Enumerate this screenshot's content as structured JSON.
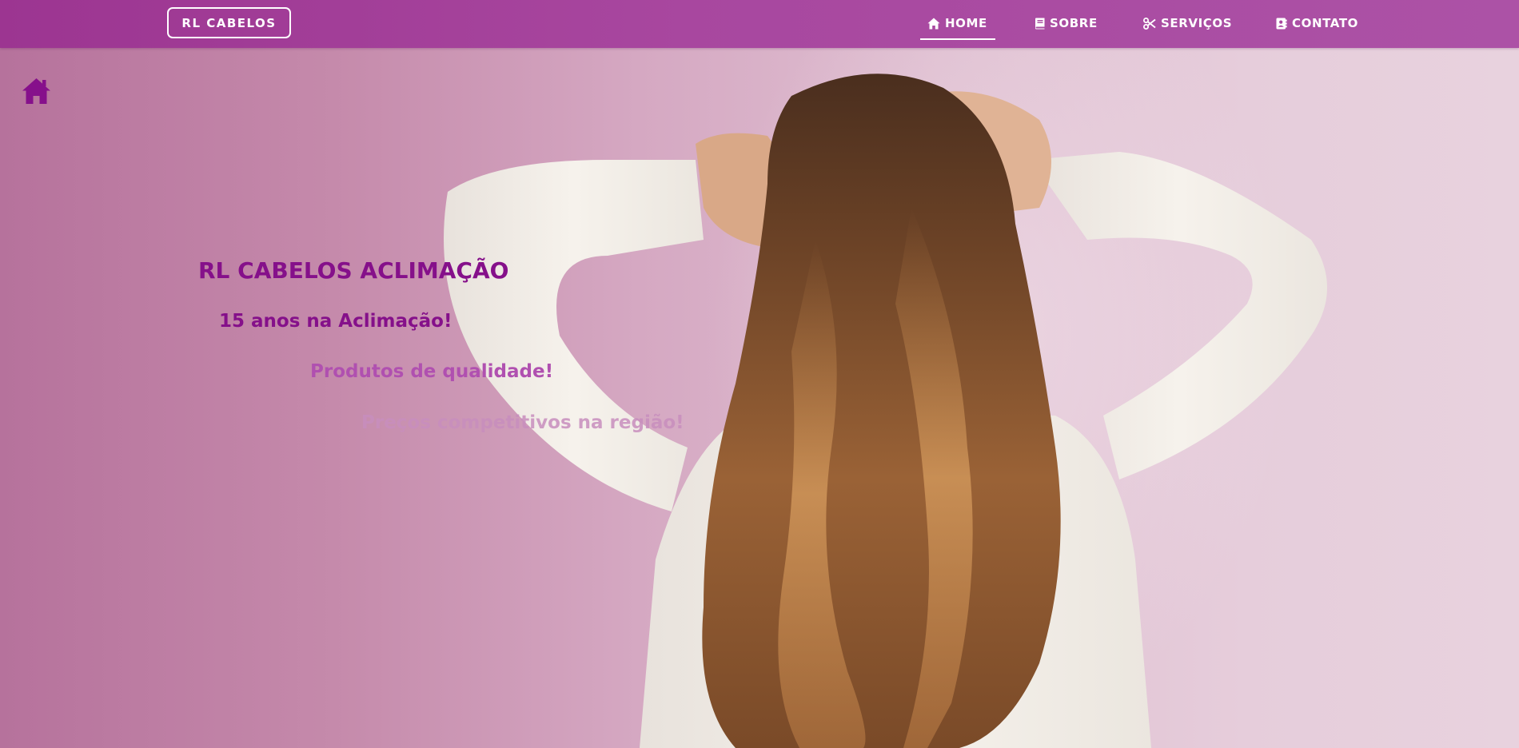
{
  "navbar": {
    "brand": "RL CABELOS",
    "items": [
      {
        "label": "HOME",
        "icon": "home-icon",
        "active": true
      },
      {
        "label": "SOBRE",
        "icon": "book-icon",
        "active": false
      },
      {
        "label": "SERVIÇOS",
        "icon": "scissors-icon",
        "active": false
      },
      {
        "label": "CONTATO",
        "icon": "address-book-icon",
        "active": false
      }
    ]
  },
  "hero": {
    "section_icon": "home-icon",
    "title": "RL CABELOS ACLIMAÇÃO",
    "lines": [
      "15 anos na Aclimação!",
      "Produtos de qualidade!",
      "Preços competitivos na região!"
    ],
    "background_image": "woman-with-long-wavy-hair-photo"
  },
  "colors": {
    "navbar": "#a8479f",
    "accent": "#85108a",
    "text_white": "#ffffff",
    "faded_line": "#c88ebe"
  }
}
